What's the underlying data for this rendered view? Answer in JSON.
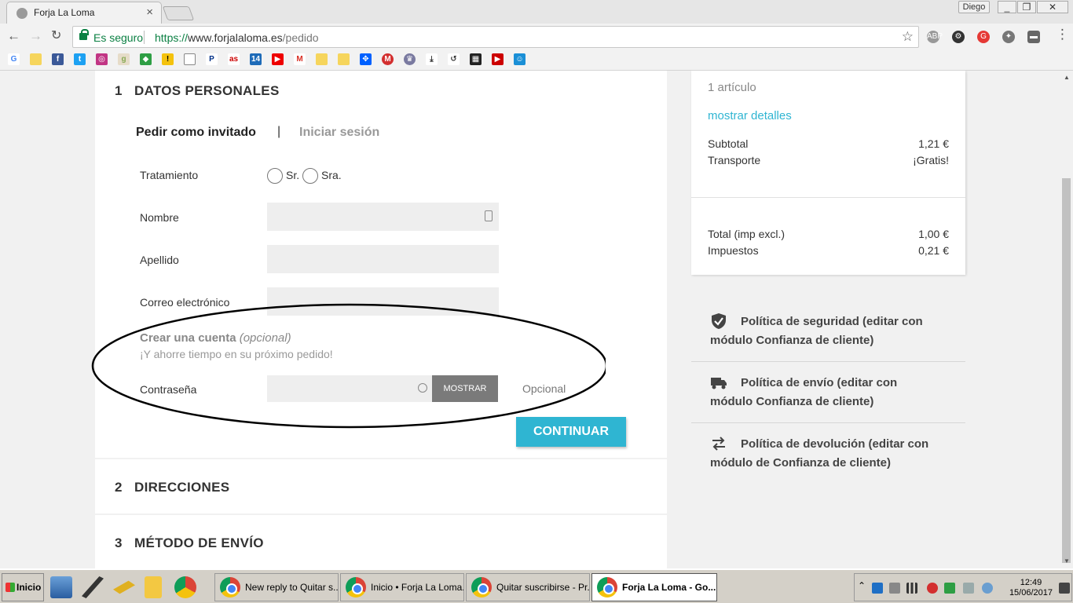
{
  "browser": {
    "tab_title": "Forja La Loma",
    "user_name": "Diego",
    "secure_label": "Es seguro",
    "url_scheme": "https://",
    "url_host": "www.forjalaloma.es",
    "url_path": "/pedido",
    "window_buttons": [
      "_",
      "❐",
      "✕"
    ]
  },
  "checkout": {
    "step1": {
      "number": "1",
      "title": "DATOS PERSONALES"
    },
    "guest_tab": "Pedir como invitado",
    "divider": "|",
    "login_tab": "Iniciar sesión",
    "form": {
      "tratamiento_label": "Tratamiento",
      "radio_sr": "Sr.",
      "radio_sra": "Sra.",
      "nombre_label": "Nombre",
      "apellido_label": "Apellido",
      "email_label": "Correo electrónico",
      "create_account_title": "Crear una cuenta",
      "create_account_optional": "(opcional)",
      "create_account_hint": "¡Y ahorre tiempo en su próximo pedido!",
      "password_label": "Contraseña",
      "show_button": "MOSTRAR",
      "optional_note": "Opcional",
      "continue_button": "CONTINUAR"
    },
    "step2": {
      "number": "2",
      "title": "DIRECCIONES"
    },
    "step3": {
      "number": "3",
      "title": "MÉTODO DE ENVÍO"
    }
  },
  "summary": {
    "items_count": "1 artículo",
    "show_details": "mostrar detalles",
    "subtotal_label": "Subtotal",
    "subtotal_value": "1,21 €",
    "shipping_label": "Transporte",
    "shipping_value": "¡Gratis!",
    "total_label": "Total (imp excl.)",
    "total_value": "1,00 €",
    "taxes_label": "Impuestos",
    "taxes_value": "0,21 €"
  },
  "policies": [
    {
      "icon": "shield-icon",
      "line1": "Política de seguridad (editar con",
      "line2": "módulo Confianza de cliente)"
    },
    {
      "icon": "truck-icon",
      "line1": "Política de envío (editar con",
      "line2": "módulo Confianza de cliente)"
    },
    {
      "icon": "arrows-exchange-icon",
      "line1": "Política de devolución (editar con",
      "line2": "módulo de Confianza de cliente)"
    }
  ],
  "taskbar": {
    "start_label": "Inicio",
    "tasks": [
      "New reply to Quitar s...",
      "Inicio • Forja La Loma...",
      "Quitar suscribirse - Pr...",
      "Forja La Loma - Go..."
    ],
    "time": "12:49",
    "date": "15/06/2017"
  },
  "colors": {
    "accent": "#2fb5d2",
    "secure_green": "#0b8043",
    "link": "#2fb5d2"
  }
}
